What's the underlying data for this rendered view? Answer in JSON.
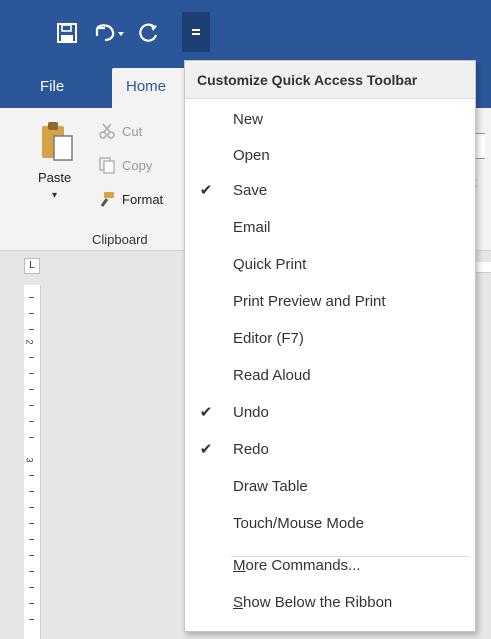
{
  "quick_access_toolbar": {
    "save_icon": "floppy-disk-icon",
    "undo_icon": "undo-icon",
    "redo_icon": "redo-icon",
    "customize_icon": "customize-qat-icon"
  },
  "tabs": {
    "file_label": "File",
    "home_label": "Home"
  },
  "clipboard": {
    "paste_label": "Paste",
    "cut_label": "Cut",
    "copy_label": "Copy",
    "format_label": "Format",
    "group_label": "Clipboard"
  },
  "ribbon_right_fragments": {
    "frag_x": "x",
    "frag_t": "t"
  },
  "ruler": {
    "corner_label": "L",
    "num_2": "2",
    "num_3": "3"
  },
  "menu": {
    "header": "Customize Quick Access Toolbar",
    "items": [
      {
        "label": "New",
        "checked": false
      },
      {
        "label": "Open",
        "checked": false
      },
      {
        "label": "Save",
        "checked": true
      },
      {
        "label": "Email",
        "checked": false
      },
      {
        "label": "Quick Print",
        "checked": false
      },
      {
        "label": "Print Preview and Print",
        "checked": false
      },
      {
        "label": "Editor (F7)",
        "checked": false
      },
      {
        "label": "Read Aloud",
        "checked": false
      },
      {
        "label": "Undo",
        "checked": true
      },
      {
        "label": "Redo",
        "checked": true
      },
      {
        "label": "Draw Table",
        "checked": false
      },
      {
        "label": "Touch/Mouse Mode",
        "checked": false
      }
    ],
    "more_commands": {
      "first": "M",
      "rest": "ore Commands..."
    },
    "show_below": {
      "first": "S",
      "rest": "how Below the Ribbon"
    },
    "check_glyph": "✔"
  },
  "colors": {
    "title_bar": "#2b579a",
    "ribbon": "#f3f3f3",
    "menu_header_bg": "#f0f0f0"
  }
}
